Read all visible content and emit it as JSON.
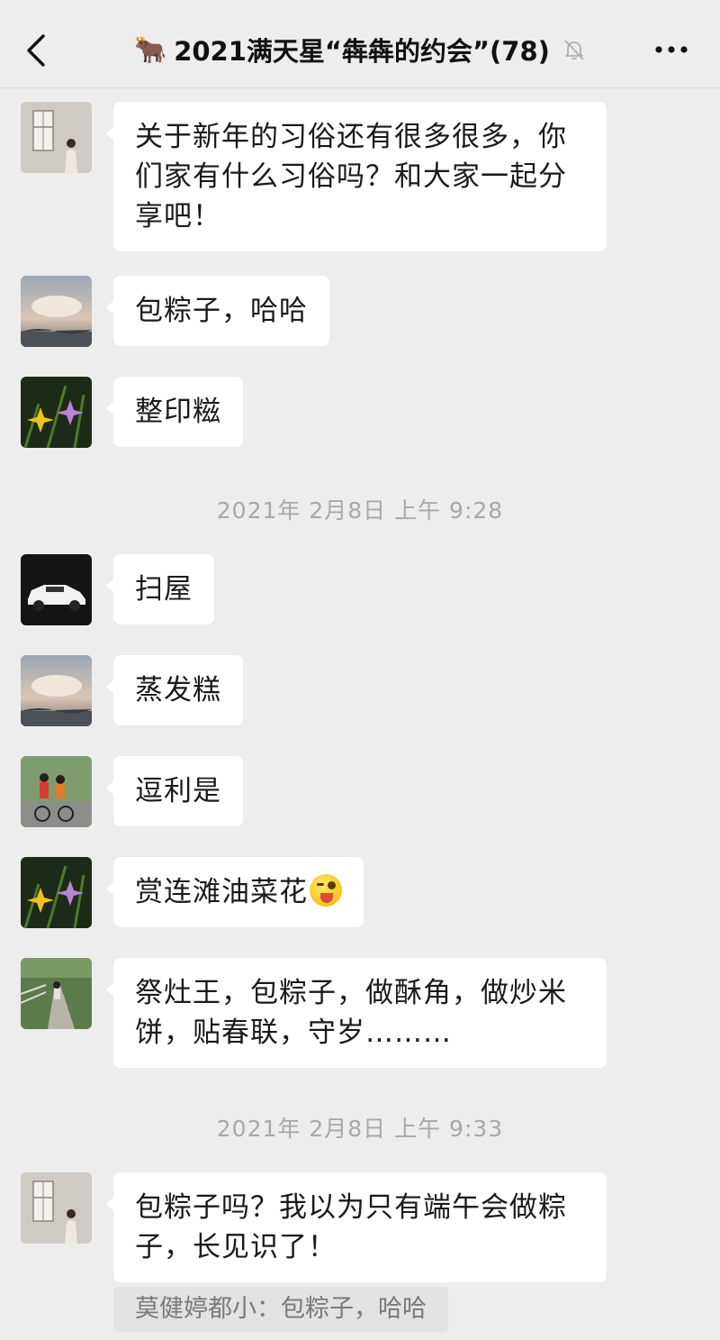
{
  "header": {
    "title": "2021满天星“犇犇的约会”(78)",
    "emoji": "🐂"
  },
  "messages": [
    {
      "avatar": "avatar-window-girl",
      "text": "关于新年的习俗还有很多很多，你们家有什么习俗吗？和大家一起分享吧！"
    },
    {
      "avatar": "avatar-cloud-lake",
      "text": "包粽子，哈哈"
    },
    {
      "avatar": "avatar-lily-flowers",
      "text": "整印糍"
    },
    {
      "avatar": "avatar-white-car",
      "text": "扫屋"
    },
    {
      "avatar": "avatar-cloud-lake",
      "text": "蒸发糕"
    },
    {
      "avatar": "avatar-bike-couple",
      "text": "逗利是"
    },
    {
      "avatar": "avatar-lily-flowers",
      "text": "赏连滩油菜花"
    },
    {
      "avatar": "avatar-path-walker",
      "text": "祭灶王，包粽子，做酥角，做炒米饼，贴春联，守岁………"
    },
    {
      "avatar": "avatar-window-girl",
      "text": "包粽子吗？我以为只有端午会做粽子，长见识了！"
    }
  ],
  "timestamps": [
    "2021年 2月8日 上午 9:28",
    "2021年 2月8日 上午 9:33"
  ],
  "quote": "莫健婷都小：包粽子，哈哈",
  "colors": {
    "background": "#ededed",
    "bubble": "#ffffff",
    "timestamp": "#a8a8a8"
  }
}
